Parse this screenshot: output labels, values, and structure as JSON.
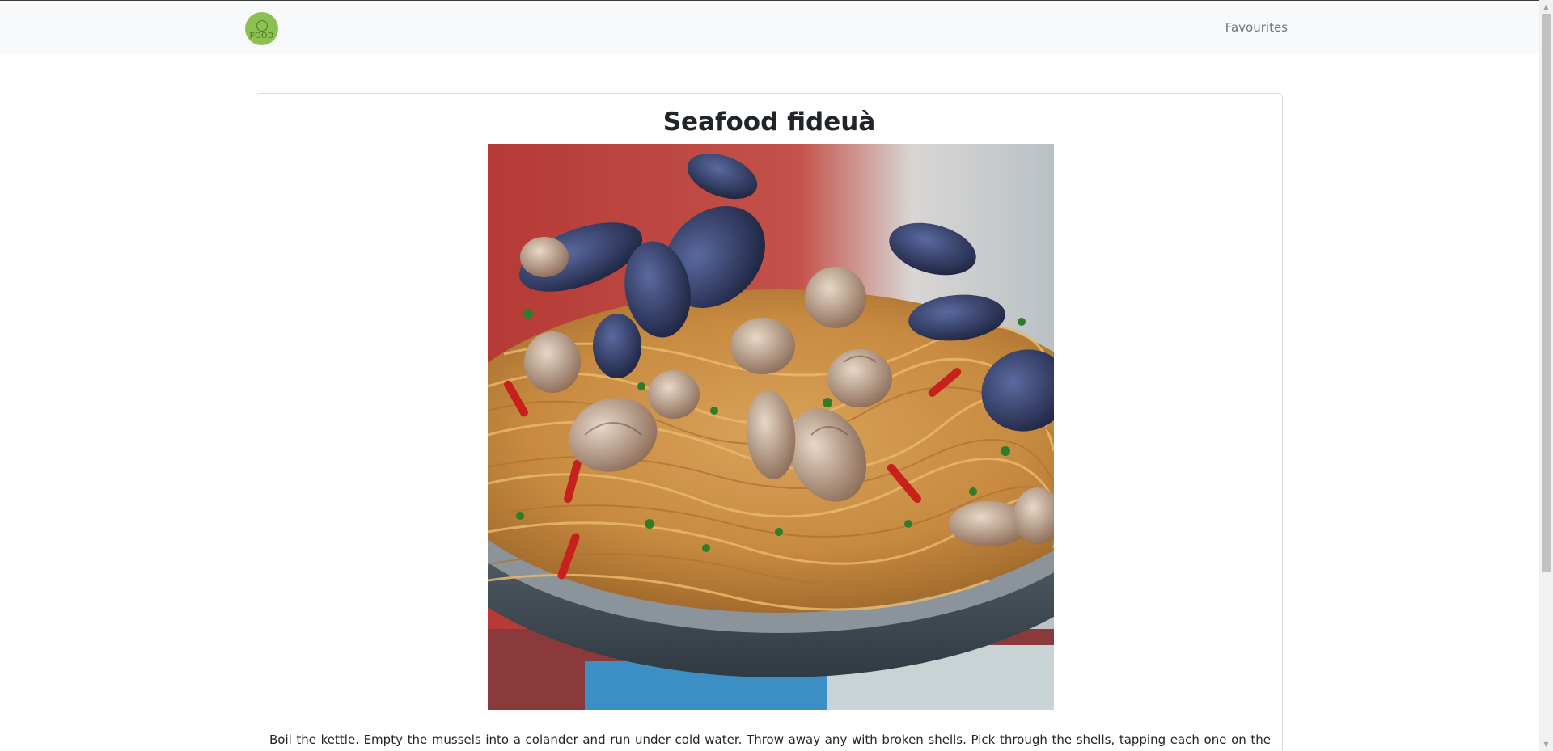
{
  "navbar": {
    "logo_text": "FOOD",
    "links": [
      {
        "label": "Favourites"
      }
    ]
  },
  "recipe": {
    "title": "Seafood fideuà",
    "image_alt": "Seafood fideuà",
    "instructions": "Boil the kettle. Empty the mussels into a colander and run under cold water. Throw away any with broken shells. Pick through the shells, tapping each one on the side of the"
  },
  "colors": {
    "navbar_bg": "#f8f9fa",
    "logo_green": "#8cc152",
    "link_gray": "#6c757d",
    "card_border": "#dfdfdf"
  },
  "icons": {
    "scroll_up": "▲",
    "scroll_down": "▼"
  }
}
